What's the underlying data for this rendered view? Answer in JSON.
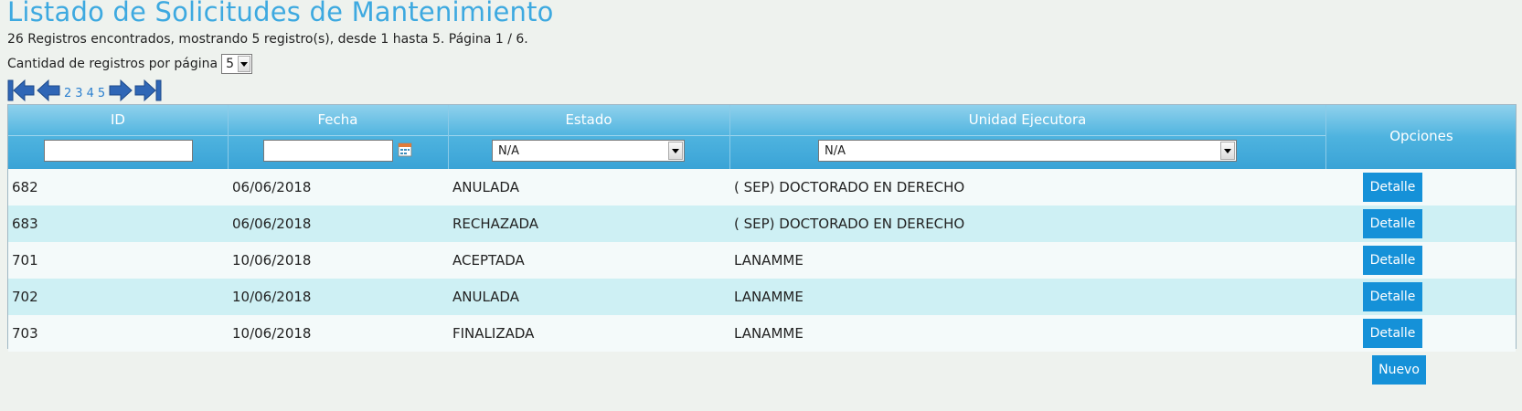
{
  "page": {
    "title": "Listado de Solicitudes de Mantenimiento",
    "summary": "26 Registros encontrados, mostrando 5 registro(s), desde 1 hasta 5. Página 1 / 6.",
    "per_page_label": "Cantidad de registros por página",
    "per_page_value": "5"
  },
  "pager": {
    "pages": [
      "2",
      "3",
      "4",
      "5"
    ],
    "icons": [
      "first-page-icon",
      "previous-page-icon",
      "next-page-icon",
      "last-page-icon"
    ]
  },
  "table": {
    "columns": [
      "ID",
      "Fecha",
      "Estado",
      "Unidad Ejecutora",
      "Opciones"
    ],
    "filters": {
      "id_value": "",
      "fecha_value": "",
      "estado_selected": "N/A",
      "unidad_selected": "N/A"
    },
    "rows": [
      {
        "id": "682",
        "fecha": "06/06/2018",
        "estado": "ANULADA",
        "unidad": "( SEP) DOCTORADO EN DERECHO",
        "action": "Detalle"
      },
      {
        "id": "683",
        "fecha": "06/06/2018",
        "estado": "RECHAZADA",
        "unidad": "( SEP) DOCTORADO EN DERECHO",
        "action": "Detalle"
      },
      {
        "id": "701",
        "fecha": "10/06/2018",
        "estado": "ACEPTADA",
        "unidad": "LANAMME",
        "action": "Detalle"
      },
      {
        "id": "702",
        "fecha": "10/06/2018",
        "estado": "ANULADA",
        "unidad": "LANAMME",
        "action": "Detalle"
      },
      {
        "id": "703",
        "fecha": "10/06/2018",
        "estado": "FINALIZADA",
        "unidad": "LANAMME",
        "action": "Detalle"
      }
    ]
  },
  "actions": {
    "new_label": "Nuevo"
  },
  "colors": {
    "title": "#3da9e0",
    "header": "#4eb3df",
    "row_alt": "#cef0f4",
    "button": "#1591d8"
  }
}
